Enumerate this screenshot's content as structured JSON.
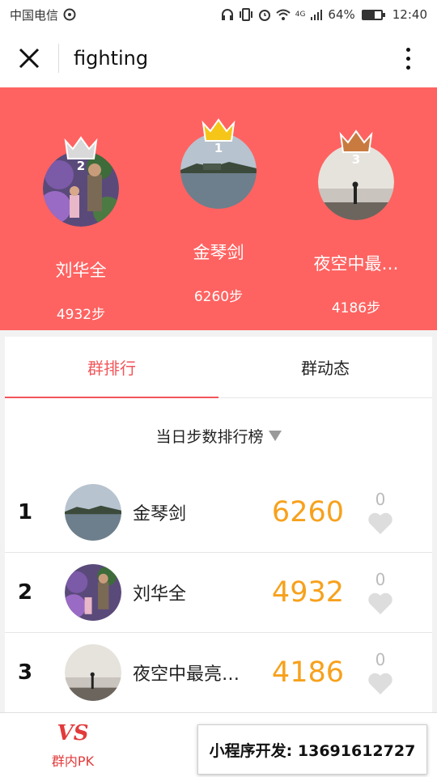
{
  "status_bar": {
    "carrier": "中国电信",
    "battery": "64%",
    "battery_level": 0.64,
    "time": "12:40",
    "network": "4G"
  },
  "header": {
    "title": "fighting"
  },
  "podium": [
    {
      "rank_label": "2",
      "name": "刘华全",
      "steps": "4932步",
      "crown_color": "#d9d9d9"
    },
    {
      "rank_label": "1",
      "name": "金琴剑",
      "steps": "6260步",
      "crown_color": "#f5c518"
    },
    {
      "rank_label": "3",
      "name": "夜空中最…",
      "steps": "4186步",
      "crown_color": "#c97b3f"
    }
  ],
  "tabs": [
    {
      "label": "群排行",
      "active": true
    },
    {
      "label": "群动态",
      "active": false
    }
  ],
  "ranking": {
    "subtitle": "当日步数排行榜",
    "rows": [
      {
        "rank": "1",
        "name": "金琴剑",
        "steps": "6260",
        "likes": "0"
      },
      {
        "rank": "2",
        "name": "刘华全",
        "steps": "4932",
        "likes": "0"
      },
      {
        "rank": "3",
        "name": "夜空中最亮…",
        "steps": "4186",
        "likes": "0"
      }
    ]
  },
  "bottom": {
    "pk_logo": "VS",
    "pk_label": "群内PK",
    "dev_banner": "小程序开发: 13691612727"
  },
  "colors": {
    "podium_bg": "#fe6361",
    "accent": "#f2555a",
    "steps": "#f7a11c"
  }
}
